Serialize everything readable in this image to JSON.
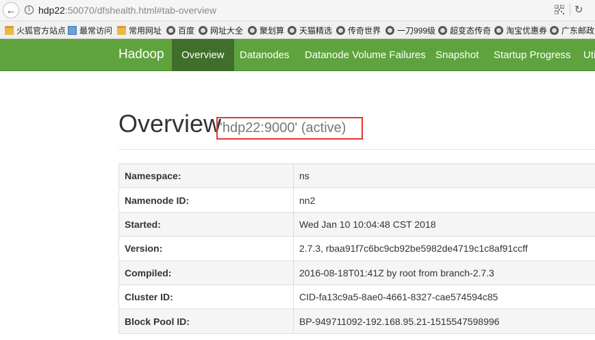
{
  "browser": {
    "url_host": "hdp22",
    "url_rest": ":50070/dfshealth.html#tab-overview",
    "bookmarks": [
      {
        "label": "火狐官方站点",
        "icon": "folder-icon"
      },
      {
        "label": "最常访问",
        "icon": "page-icon"
      },
      {
        "label": "常用网址",
        "icon": "folder-icon"
      },
      {
        "label": "百度",
        "icon": "globe-icon"
      },
      {
        "label": "网址大全",
        "icon": "globe-icon"
      },
      {
        "label": "聚划算",
        "icon": "globe-icon"
      },
      {
        "label": "天猫精选",
        "icon": "globe-icon"
      },
      {
        "label": "传奇世界",
        "icon": "globe-icon"
      },
      {
        "label": "一刀999级",
        "icon": "globe-icon"
      },
      {
        "label": "超变态传奇",
        "icon": "globe-icon"
      },
      {
        "label": "淘宝优惠券",
        "icon": "globe-icon"
      },
      {
        "label": "广东邮政",
        "icon": "globe-icon"
      }
    ]
  },
  "navbar": {
    "brand": "Hadoop",
    "items": [
      "Overview",
      "Datanodes",
      "Datanode Volume Failures",
      "Snapshot",
      "Startup Progress",
      "Utilities"
    ],
    "active_index": 0,
    "color": "#5fa33e",
    "active_color": "#3f6f2a"
  },
  "header": {
    "title": "Overview",
    "subtitle": "'hdp22:9000' (active)",
    "highlight_color": "#e03636"
  },
  "overview_table": [
    {
      "key": "Namespace:",
      "value": "ns"
    },
    {
      "key": "Namenode ID:",
      "value": "nn2"
    },
    {
      "key": "Started:",
      "value": "Wed Jan 10 10:04:48 CST 2018"
    },
    {
      "key": "Version:",
      "value": "2.7.3, rbaa91f7c6bc9cb92be5982de4719c1c8af91ccff"
    },
    {
      "key": "Compiled:",
      "value": "2016-08-18T01:41Z by root from branch-2.7.3"
    },
    {
      "key": "Cluster ID:",
      "value": "CID-fa13c9a5-8ae0-4661-8327-cae574594c85"
    },
    {
      "key": "Block Pool ID:",
      "value": "BP-949711092-192.168.95.21-1515547598996"
    }
  ]
}
